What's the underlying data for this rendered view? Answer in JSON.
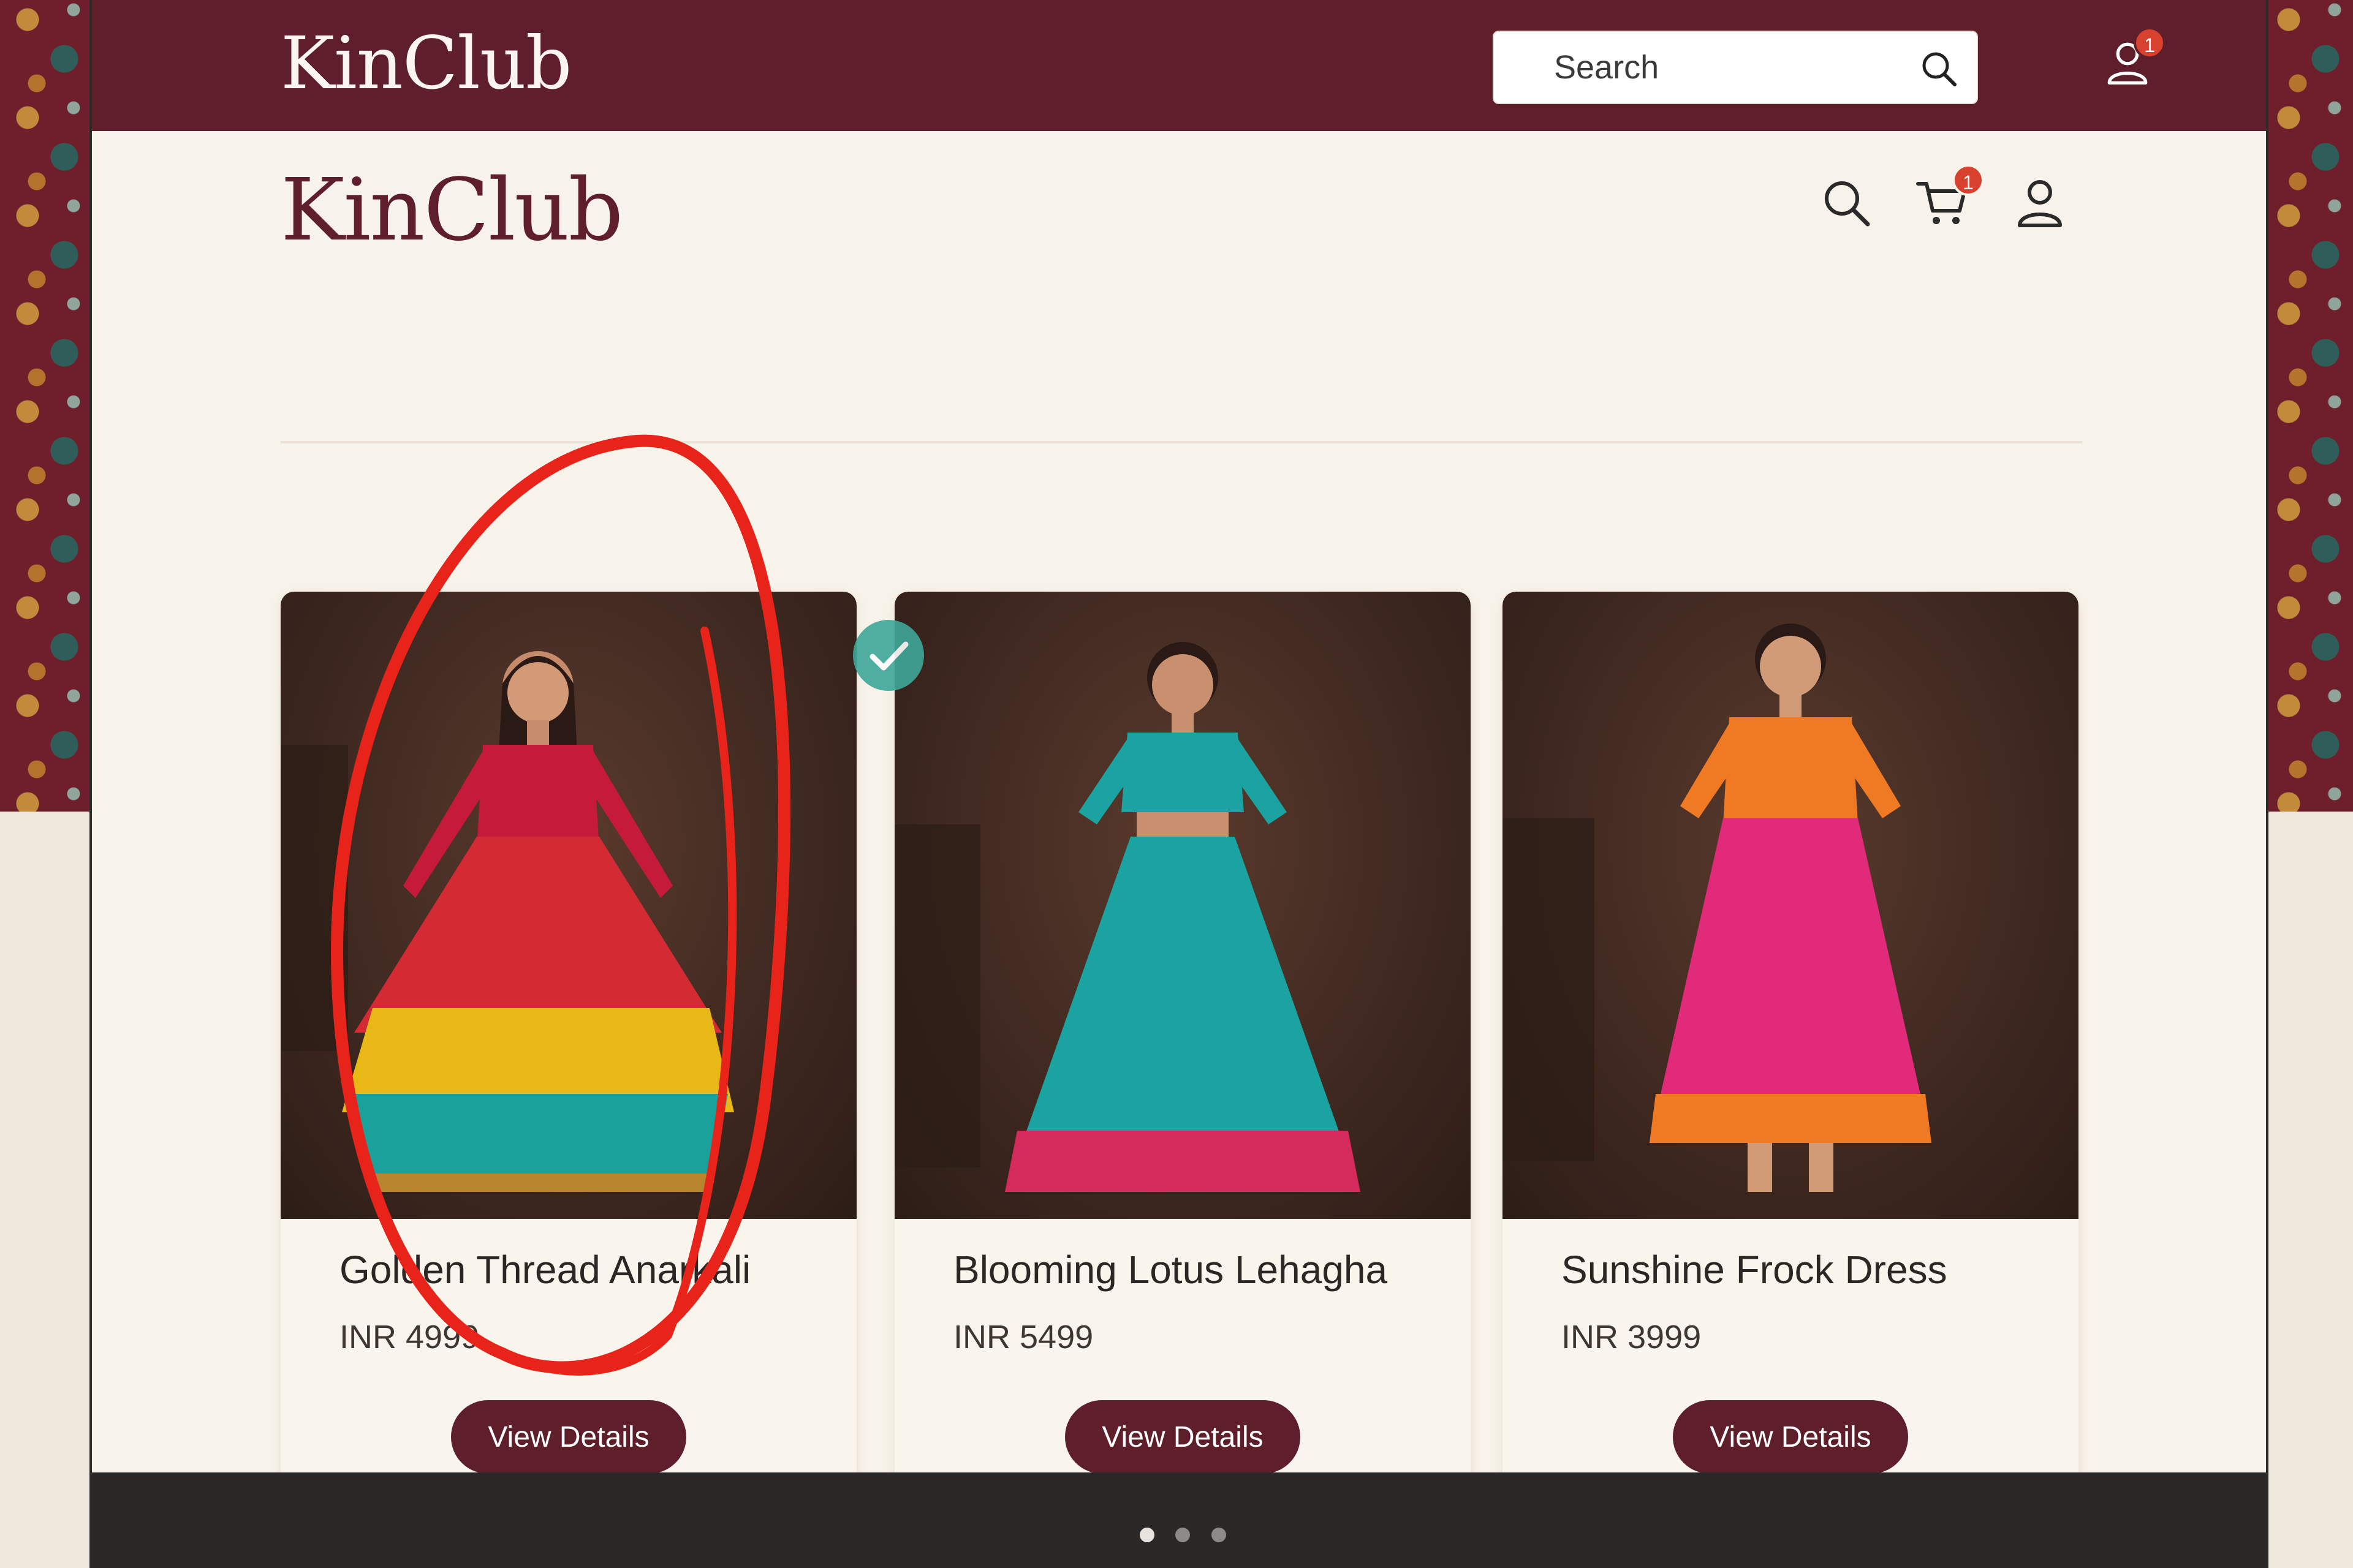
{
  "topbar": {
    "brand": "KinClub",
    "search_placeholder": "Search",
    "user_badge_count": "1"
  },
  "header": {
    "brand": "KinClub",
    "cart_badge_count": "1"
  },
  "products": [
    {
      "name": "Golden Thread Anarkali",
      "price": "INR 4999",
      "button_label": "View Details",
      "selected": true
    },
    {
      "name": "Blooming Lotus Lehagha",
      "price": "INR 5499",
      "button_label": "View Details"
    },
    {
      "name": "Sunshine Frock Dress",
      "price": "INR 3999",
      "button_label": "View Details"
    }
  ],
  "carousel": {
    "total_pages": 3,
    "active_page": 1
  },
  "colors": {
    "brand": "#5e1f2b",
    "badge": "#d9412f",
    "annotation": "#e8231a",
    "selected_check": "#3ea79a"
  },
  "icons": [
    "search-icon",
    "user-icon",
    "cart-icon",
    "check-icon"
  ]
}
